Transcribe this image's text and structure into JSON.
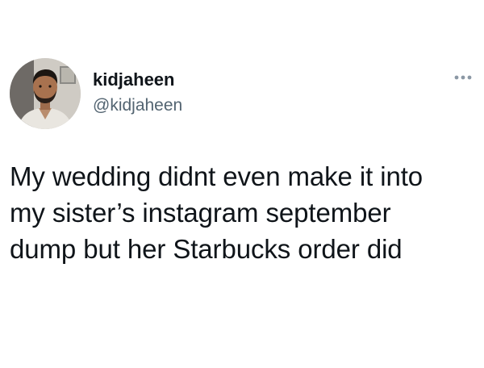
{
  "tweet": {
    "author": {
      "display_name": "kidjaheen",
      "handle": "@kidjaheen",
      "avatar_icon": "profile-photo"
    },
    "menu_icon": "more-options-icon",
    "text": "My wedding didnt even make it into\nmy sister’s instagram september\ndump but her Starbucks order did"
  },
  "colors": {
    "text_primary": "#0f1419",
    "text_secondary": "#536471",
    "background": "#ffffff"
  }
}
